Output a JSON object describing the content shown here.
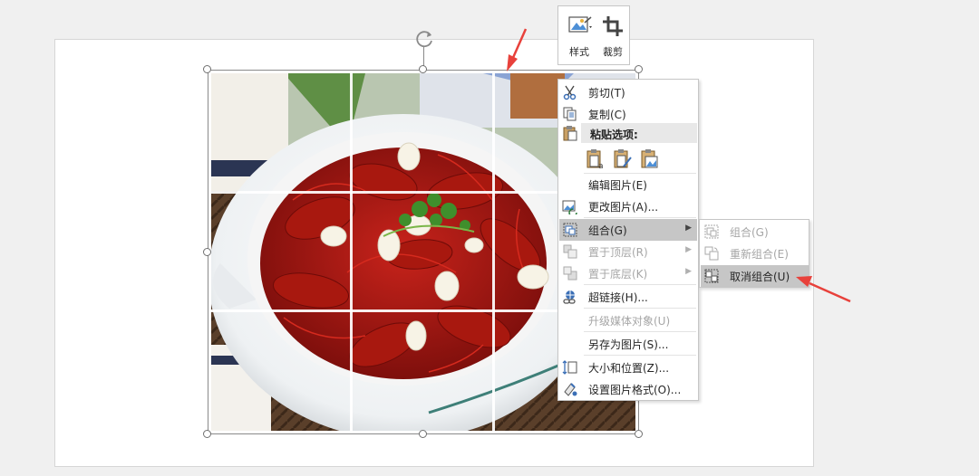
{
  "mini_toolbar": {
    "style_label": "样式",
    "crop_label": "裁剪"
  },
  "context_menu": {
    "items": [
      {
        "label": "剪切(T)",
        "icon": "scissors-icon",
        "enabled": true
      },
      {
        "label": "复制(C)",
        "icon": "copy-icon",
        "enabled": true
      },
      {
        "label": "粘贴选项:",
        "icon": "clipboard-icon",
        "enabled": true
      },
      {
        "label": "编辑图片(E)",
        "icon": "",
        "enabled": true
      },
      {
        "label": "更改图片(A)...",
        "icon": "change-picture-icon",
        "enabled": true
      },
      {
        "label": "组合(G)",
        "icon": "group-icon",
        "enabled": true,
        "has_submenu": true,
        "highlighted": true
      },
      {
        "label": "置于顶层(R)",
        "icon": "bring-to-front-icon",
        "enabled": false,
        "has_submenu": true
      },
      {
        "label": "置于底层(K)",
        "icon": "send-to-back-icon",
        "enabled": false,
        "has_submenu": true
      },
      {
        "label": "超链接(H)...",
        "icon": "hyperlink-icon",
        "enabled": true
      },
      {
        "label": "升级媒体对象(U)",
        "icon": "",
        "enabled": false
      },
      {
        "label": "另存为图片(S)...",
        "icon": "",
        "enabled": true
      },
      {
        "label": "大小和位置(Z)...",
        "icon": "size-position-icon",
        "enabled": true
      },
      {
        "label": "设置图片格式(O)...",
        "icon": "format-picture-icon",
        "enabled": true
      }
    ]
  },
  "submenu": {
    "items": [
      {
        "label": "组合(G)",
        "icon": "group-icon",
        "enabled": false
      },
      {
        "label": "重新组合(E)",
        "icon": "regroup-icon",
        "enabled": false
      },
      {
        "label": "取消组合(U)",
        "icon": "ungroup-icon",
        "enabled": true,
        "highlighted": true
      }
    ]
  },
  "colors": {
    "annotation_arrow": "#e8413b",
    "menu_highlight": "#c6c6c6",
    "disabled_text": "#a6a6a6"
  }
}
